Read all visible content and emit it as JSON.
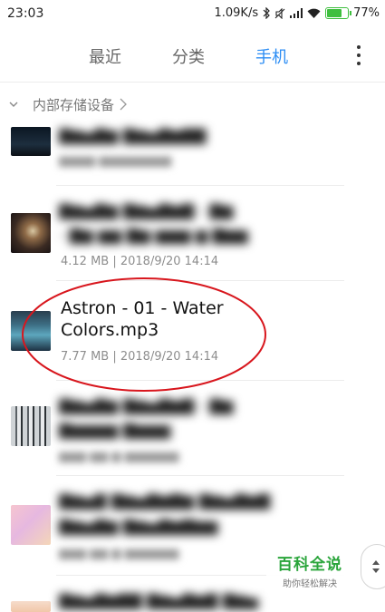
{
  "status_bar": {
    "time": "23:03",
    "network_speed": "1.09K/s",
    "battery_percent": "77%",
    "battery_level": 0.77,
    "battery_color": "#3fbf3f"
  },
  "tabs": [
    {
      "label": "最近",
      "active": false
    },
    {
      "label": "分类",
      "active": false
    },
    {
      "label": "手机",
      "active": true
    }
  ],
  "accent_color": "#2c8df4",
  "breadcrumb": {
    "label": "内部存储设备"
  },
  "files": {
    "partial_top": {
      "blurred": true
    },
    "previous": {
      "meta": "4.12 MB | 2018/9/20 14:14",
      "blurred_title": true
    },
    "highlighted": {
      "title": "Astron - 01 - Water Colors.mp3",
      "meta": "7.77 MB | 2018/9/20 14:14"
    },
    "next": {
      "blurred": true
    },
    "after_next": {
      "blurred": true
    },
    "partial_bottom": {
      "blurred": true
    }
  },
  "highlight_color": "#d8161d",
  "watermark": {
    "main": "百科全说",
    "sub": "助你轻松解决"
  },
  "icons": [
    "bluetooth-icon",
    "mute-icon",
    "signal-icon",
    "wifi-icon",
    "battery-icon",
    "more-icon",
    "chevron-down-icon",
    "chevron-right-icon",
    "sort-icon"
  ]
}
